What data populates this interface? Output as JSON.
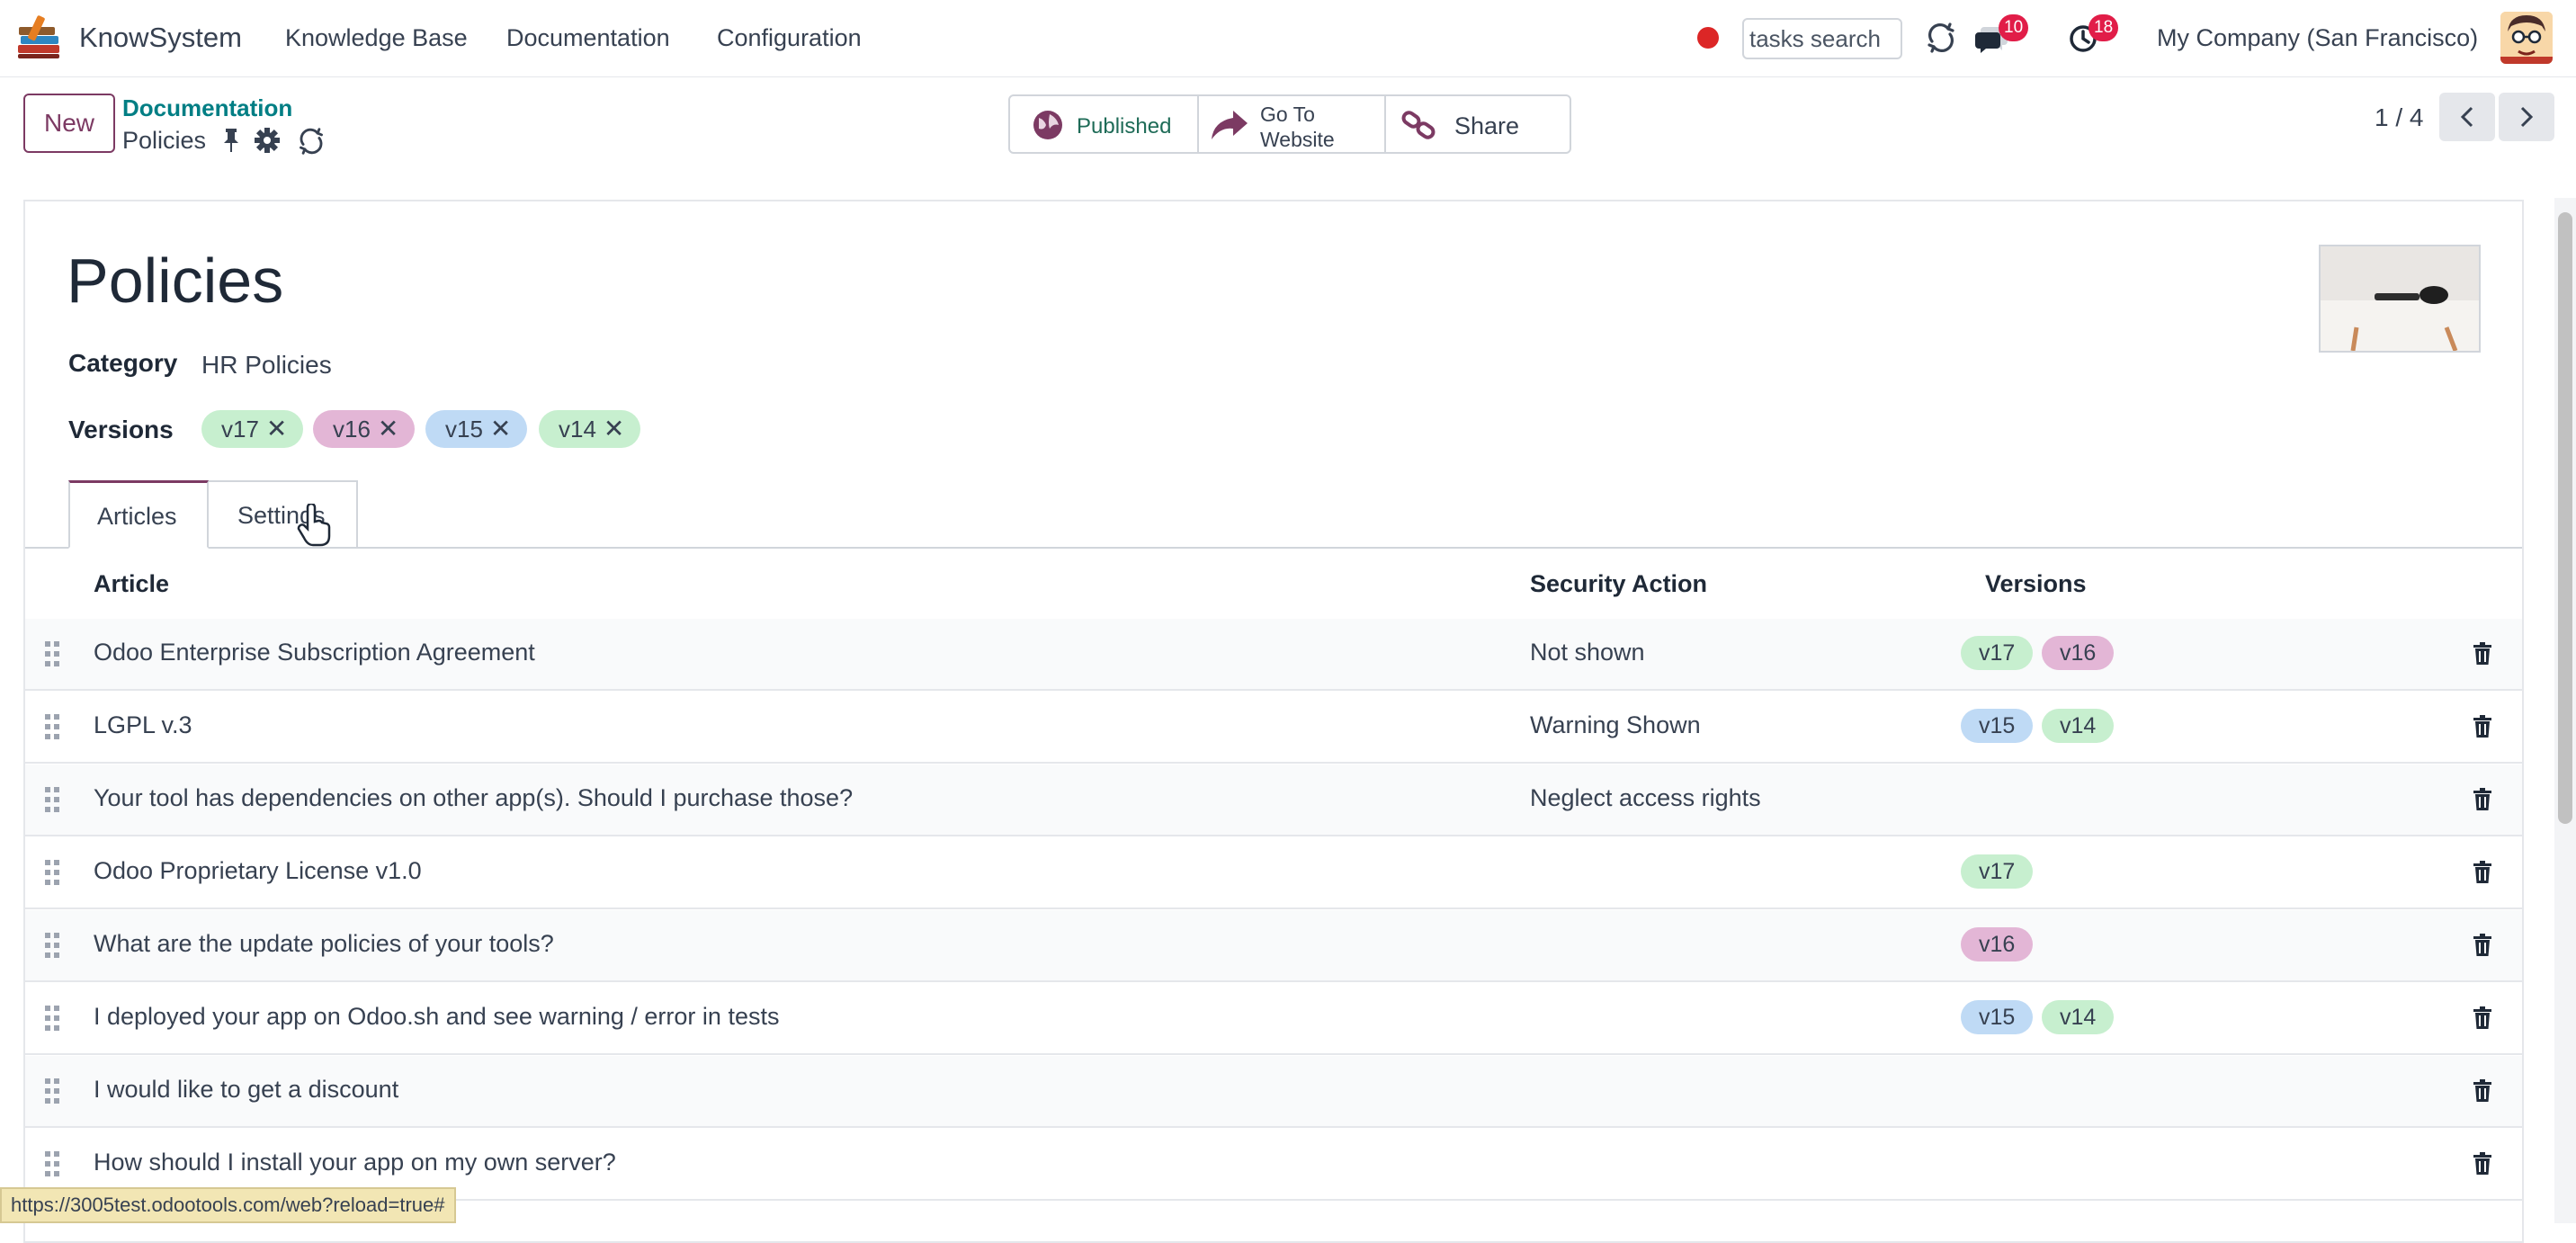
{
  "navbar": {
    "app_name": "KnowSystem",
    "menus": [
      "Knowledge Base",
      "Documentation",
      "Configuration"
    ],
    "search_placeholder": "tasks search",
    "messages_count": "10",
    "activities_count": "18",
    "company": "My Company (San Francisco)"
  },
  "control_panel": {
    "new_label": "New",
    "breadcrumb_parent": "Documentation",
    "breadcrumb_current": "Policies",
    "published_label": "Published",
    "goto_line1": "Go To",
    "goto_line2": "Website",
    "share_label": "Share",
    "pager": "1 / 4"
  },
  "form": {
    "title": "Policies",
    "category_label": "Category",
    "category_value": "HR Policies",
    "versions_label": "Versions",
    "version_tags": [
      "v17",
      "v16",
      "v15",
      "v14"
    ],
    "tabs": [
      "Articles",
      "Settings"
    ]
  },
  "articles": {
    "headers": [
      "Article",
      "Security Action",
      "Versions"
    ],
    "rows": [
      {
        "article": "Odoo Enterprise Subscription Agreement",
        "security": "Not shown",
        "versions": [
          "v17",
          "v16"
        ]
      },
      {
        "article": "LGPL v.3",
        "security": "Warning Shown",
        "versions": [
          "v15",
          "v14"
        ]
      },
      {
        "article": "Your tool has dependencies on other app(s). Should I purchase those?",
        "security": "Neglect access rights",
        "versions": []
      },
      {
        "article": "Odoo Proprietary License v1.0",
        "security": "",
        "versions": [
          "v17"
        ]
      },
      {
        "article": "What are the update policies of your tools?",
        "security": "",
        "versions": [
          "v16"
        ]
      },
      {
        "article": "I deployed your app on Odoo.sh and see warning / error in tests",
        "security": "",
        "versions": [
          "v15",
          "v14"
        ]
      },
      {
        "article": "I would like to get a discount",
        "security": "",
        "versions": []
      },
      {
        "article": "How should I install your app on my own server?",
        "security": "",
        "versions": []
      }
    ]
  },
  "status_url": "https://3005test.odootools.com/web?reload=true#",
  "colors": {
    "brand": "#7c3a63",
    "breadcrumb": "#017e84",
    "badge": "#e11d48",
    "tag_v17": "#c7efcf",
    "tag_v16": "#e3b6d6",
    "tag_v15": "#bfdaf5",
    "tag_v14": "#c7efcf"
  }
}
